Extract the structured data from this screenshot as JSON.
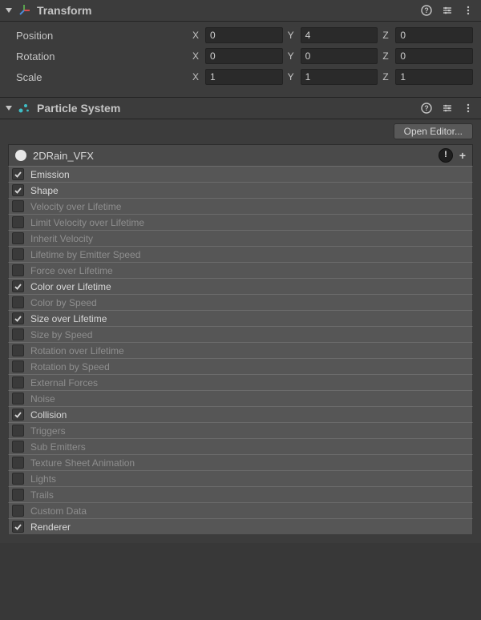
{
  "transform": {
    "title": "Transform",
    "position": {
      "label": "Position",
      "x": "0",
      "y": "4",
      "z": "0",
      "xl": "X",
      "yl": "Y",
      "zl": "Z"
    },
    "rotation": {
      "label": "Rotation",
      "x": "0",
      "y": "0",
      "z": "0",
      "xl": "X",
      "yl": "Y",
      "zl": "Z"
    },
    "scale": {
      "label": "Scale",
      "x": "1",
      "y": "1",
      "z": "1",
      "xl": "X",
      "yl": "Y",
      "zl": "Z"
    }
  },
  "particle_system": {
    "title": "Particle System",
    "open_editor_label": "Open Editor...",
    "name": "2DRain_VFX",
    "tip": "!",
    "plus": "+",
    "modules": [
      {
        "label": "Emission",
        "enabled": true
      },
      {
        "label": "Shape",
        "enabled": true
      },
      {
        "label": "Velocity over Lifetime",
        "enabled": false
      },
      {
        "label": "Limit Velocity over Lifetime",
        "enabled": false
      },
      {
        "label": "Inherit Velocity",
        "enabled": false
      },
      {
        "label": "Lifetime by Emitter Speed",
        "enabled": false
      },
      {
        "label": "Force over Lifetime",
        "enabled": false
      },
      {
        "label": "Color over Lifetime",
        "enabled": true
      },
      {
        "label": "Color by Speed",
        "enabled": false
      },
      {
        "label": "Size over Lifetime",
        "enabled": true
      },
      {
        "label": "Size by Speed",
        "enabled": false
      },
      {
        "label": "Rotation over Lifetime",
        "enabled": false
      },
      {
        "label": "Rotation by Speed",
        "enabled": false
      },
      {
        "label": "External Forces",
        "enabled": false
      },
      {
        "label": "Noise",
        "enabled": false
      },
      {
        "label": "Collision",
        "enabled": true
      },
      {
        "label": "Triggers",
        "enabled": false
      },
      {
        "label": "Sub Emitters",
        "enabled": false
      },
      {
        "label": "Texture Sheet Animation",
        "enabled": false
      },
      {
        "label": "Lights",
        "enabled": false
      },
      {
        "label": "Trails",
        "enabled": false
      },
      {
        "label": "Custom Data",
        "enabled": false
      },
      {
        "label": "Renderer",
        "enabled": true
      }
    ]
  }
}
